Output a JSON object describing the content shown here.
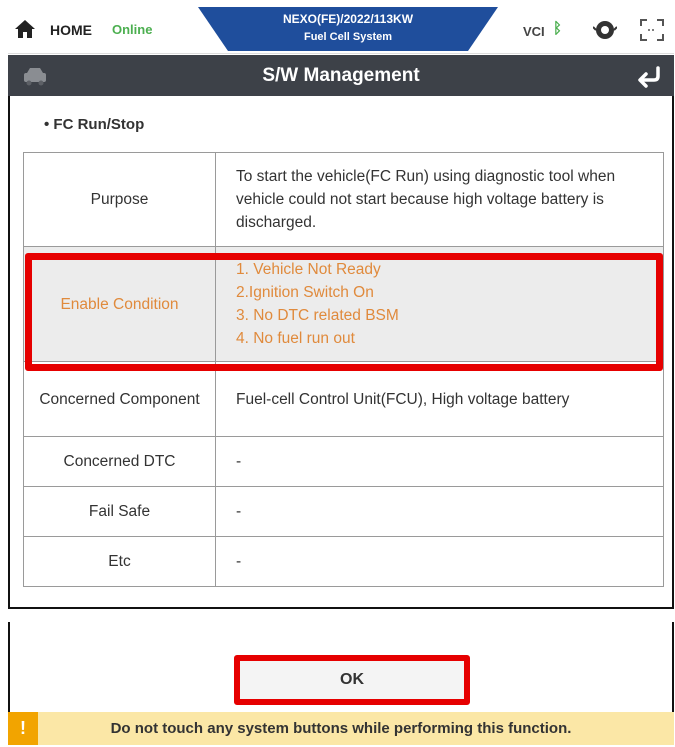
{
  "topbar": {
    "home_label": "HOME",
    "status_label": "Online",
    "vehicle_title": "NEXO(FE)/2022/113KW",
    "system_title": "Fuel Cell System",
    "vci_label": "VCI",
    "icons": [
      "home-icon",
      "bluetooth-icon",
      "engine-icon",
      "fullscreen-icon"
    ],
    "colors": {
      "online": "#4caf50",
      "title_tab": "#1f4e9c"
    }
  },
  "header": {
    "title": "S/W Management",
    "icons": [
      "car-icon",
      "back-icon"
    ],
    "background": "#3d4148"
  },
  "section": {
    "title": "• FC Run/Stop"
  },
  "table": {
    "rows": [
      {
        "label": "Purpose",
        "value": "To start the vehicle(FC Run) using diagnostic tool when vehicle could not start because high voltage battery is discharged."
      },
      {
        "label": "Enable Condition",
        "lines": [
          "1. Vehicle Not Ready",
          "2.Ignition Switch On",
          "3. No DTC related BSM",
          "4. No fuel run out"
        ]
      },
      {
        "label": "Concerned Component",
        "value": "Fuel-cell Control Unit(FCU), High voltage battery"
      },
      {
        "label": "Concerned DTC",
        "value": "-"
      },
      {
        "label": "Fail Safe",
        "value": "-"
      },
      {
        "label": "Etc",
        "value": "-"
      }
    ],
    "highlight_color": "#e60000",
    "condition_color": "#e08a3c"
  },
  "footer": {
    "ok_label": "OK",
    "warning_icon": "!",
    "warning_text": "Do not touch any system buttons while performing this function.",
    "warning_color": "#fbe7a6"
  }
}
